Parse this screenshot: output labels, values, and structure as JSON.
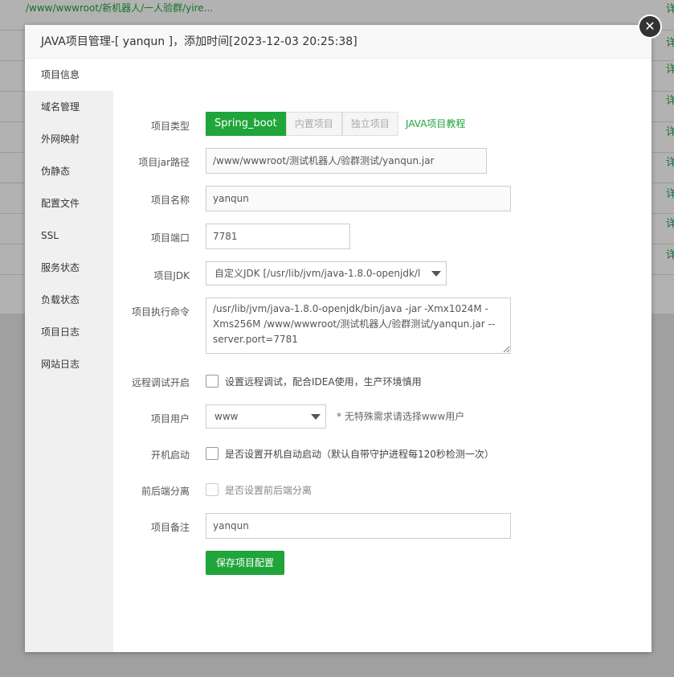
{
  "background": {
    "top_link": "/www/wwwroot/新机器人/一人验群/yire...",
    "right_labels": [
      "详",
      "详",
      "详",
      "详",
      "详",
      "详",
      "详",
      "详",
      "详"
    ]
  },
  "dialog": {
    "title": "JAVA项目管理-[ yanqun ]，添加时间[2023-12-03 20:25:38]",
    "close_glyph": "✕"
  },
  "sidebar": {
    "items": [
      {
        "label": "项目信息"
      },
      {
        "label": "域名管理"
      },
      {
        "label": "外网映射"
      },
      {
        "label": "伪静态"
      },
      {
        "label": "配置文件"
      },
      {
        "label": "SSL"
      },
      {
        "label": "服务状态"
      },
      {
        "label": "负载状态"
      },
      {
        "label": "项目日志"
      },
      {
        "label": "网站日志"
      }
    ]
  },
  "form": {
    "type_label": "项目类型",
    "type_options": [
      "Spring_boot",
      "内置项目",
      "独立项目"
    ],
    "tutorial_link": "JAVA项目教程",
    "jar_label": "项目jar路径",
    "jar_value": "/www/wwwroot/测试机器人/验群测试/yanqun.jar",
    "name_label": "项目名称",
    "name_value": "yanqun",
    "port_label": "项目端口",
    "port_value": "7781",
    "jdk_label": "项目JDK",
    "jdk_value": "自定义JDK [/usr/lib/jvm/java-1.8.0-openjdk/l",
    "cmd_label": "项目执行命令",
    "cmd_value": "/usr/lib/jvm/java-1.8.0-openjdk/bin/java -jar -Xmx1024M -Xms256M  /www/wwwroot/测试机器人/验群测试/yanqun.jar --server.port=7781",
    "debug_label": "远程调试开启",
    "debug_text": "设置远程调试，配合IDEA使用，生产环境慎用",
    "user_label": "项目用户",
    "user_value": "www",
    "user_hint": "* 无特殊需求请选择www用户",
    "boot_label": "开机启动",
    "boot_text": "是否设置开机自动启动（默认自带守护进程每120秒检测一次）",
    "split_label": "前后端分离",
    "split_text": "是否设置前后端分离",
    "remark_label": "项目备注",
    "remark_value": "yanqun",
    "save_label": "保存项目配置"
  },
  "colors": {
    "accent": "#20a53a"
  }
}
